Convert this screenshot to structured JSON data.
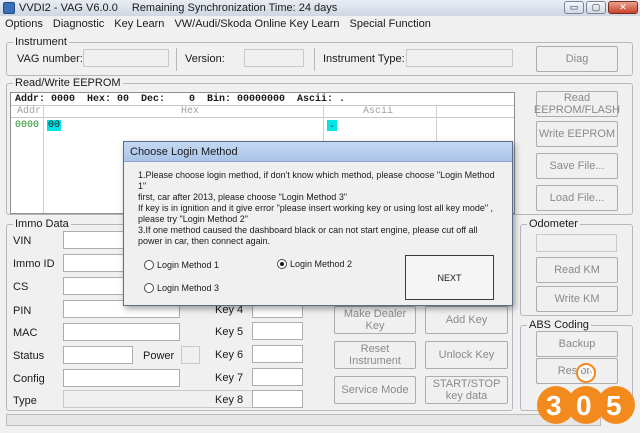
{
  "window": {
    "title": "VVDI2 - VAG V6.0.0",
    "sync_status": "Remaining Synchronization Time: 24 days",
    "minimize": "▭",
    "maximize": "▢",
    "close": "✕"
  },
  "menu": [
    "Options",
    "Diagnostic",
    "Key Learn",
    "VW/Audi/Skoda Online Key Learn",
    "Special Function"
  ],
  "instrument": {
    "legend": "Instrument",
    "vag_label": "VAG number:",
    "version_label": "Version:",
    "type_label": "Instrument Type:",
    "diag_button": "Diag"
  },
  "eeprom": {
    "legend": "Read/Write EEPROM",
    "status_line": "Addr: 0000  Hex: 00  Dec:    0  Bin: 00000000  Ascii: .",
    "col_addr": "Addr",
    "col_hex": "Hex",
    "col_ascii": "Ascii",
    "row_addr": "0000",
    "row_hex": "00",
    "row_ascii": ".",
    "read_button": "Read EEPROM/FLASH",
    "write_button": "Write EEPROM",
    "save_button": "Save File...",
    "load_button": "Load File..."
  },
  "immo": {
    "legend": "Immo Data",
    "fields": [
      "VIN",
      "Immo ID",
      "CS",
      "PIN",
      "MAC",
      "Status",
      "Config",
      "Type"
    ],
    "power_label": "Power",
    "keys": [
      "Key 4",
      "Key 5",
      "Key 6",
      "Key 7",
      "Key 8"
    ],
    "make_dealer_key": "Make Dealer Key",
    "add_key": "Add Key",
    "reset_instrument": "Reset Instrument",
    "unlock_key": "Unlock Key",
    "service_mode": "Service Mode",
    "start_stop_key": "START/STOP key data"
  },
  "odometer": {
    "legend": "Odometer",
    "read_km": "Read KM",
    "write_km": "Write KM"
  },
  "abs": {
    "legend": "ABS Coding",
    "backup": "Backup",
    "restore": "Restore"
  },
  "dialog": {
    "title": "Choose Login Method",
    "lines": [
      "1.Please choose login method, if don't know which method, please choose \"Login Method 1\"",
      "first, car after 2013, please choose \"Login Method 3\"",
      "If key is in ignition and it give error \"please insert working key or using lost all key mode\" ,",
      "please try \"Login Method 2\"",
      "3.If one method caused the dashboard black or can not start engine, please cut off all",
      "power in car, then connect again."
    ],
    "method1": "Login Method 1",
    "method2": "Login Method 2",
    "method3": "Login Method 3",
    "selected": "Login Method 2",
    "next_button": "NEXT"
  },
  "watermark": "305",
  "colors": {
    "hex_highlight": "#00e5e5",
    "addr_text": "#1e8c1e",
    "dialog_titlebar": "#b6cde9",
    "logo_orange": "#f28a1e"
  }
}
